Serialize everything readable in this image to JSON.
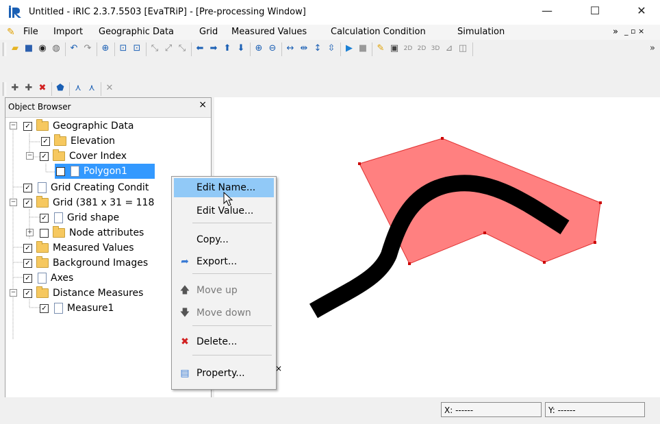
{
  "window": {
    "title": "Untitled - iRIC 2.3.7.5503 [EvaTRiP] - [Pre-processing Window]",
    "minimize_glyph": "—",
    "maximize_glyph": "☐",
    "close_glyph": "✕"
  },
  "menubar": {
    "items": [
      "File",
      "Import",
      "Geographic Data",
      "Grid",
      "Measured Values",
      "Calculation Condition",
      "Simulation"
    ],
    "overflow": "»",
    "mdi_buttons": "_ ▫ ×"
  },
  "object_browser": {
    "title": "Object Browser",
    "close_glyph": "×",
    "tree": [
      {
        "label": "Geographic Data",
        "checked": true,
        "icon": "folder-icon",
        "expander": "−"
      },
      {
        "label": "Elevation",
        "checked": true,
        "icon": "folder-icon"
      },
      {
        "label": "Cover Index",
        "checked": true,
        "icon": "folder-icon",
        "expander": "−"
      },
      {
        "label": "Polygon1",
        "checked": true,
        "icon": "document-icon",
        "selected": true
      },
      {
        "label": "Grid Creating Condit",
        "checked": true,
        "icon": "document-icon"
      },
      {
        "label": "Grid (381 x 31 = 118",
        "checked": true,
        "icon": "folder-icon",
        "expander": "−"
      },
      {
        "label": "Grid shape",
        "checked": true,
        "icon": "document-icon"
      },
      {
        "label": "Node attributes",
        "checked": false,
        "icon": "folder-icon",
        "expander": "+"
      },
      {
        "label": "Measured Values",
        "checked": true,
        "icon": "folder-icon"
      },
      {
        "label": "Background Images",
        "checked": true,
        "icon": "folder-icon"
      },
      {
        "label": "Axes",
        "checked": true,
        "icon": "document-icon"
      },
      {
        "label": "Distance Measures",
        "checked": true,
        "icon": "folder-icon",
        "expander": "−"
      },
      {
        "label": "Measure1",
        "checked": true,
        "icon": "document-icon"
      }
    ]
  },
  "context_menu": {
    "items": [
      {
        "label": "Edit Name...",
        "icon": "",
        "highlighted": true
      },
      {
        "label": "Edit Value...",
        "icon": ""
      },
      {
        "separator": true
      },
      {
        "label": "Copy...",
        "icon": ""
      },
      {
        "label": "Export...",
        "icon": "export-icon"
      },
      {
        "separator": true
      },
      {
        "label": "Move up",
        "icon": "arrow-up-icon",
        "disabled": true
      },
      {
        "label": "Move down",
        "icon": "arrow-down-icon",
        "disabled": true
      },
      {
        "separator": true
      },
      {
        "label": "Delete...",
        "icon": "delete-icon"
      },
      {
        "separator": true
      },
      {
        "label": "Property...",
        "icon": "property-icon"
      }
    ]
  },
  "statusbar": {
    "x_label": "X: ------",
    "y_label": "Y: ------"
  },
  "colors": {
    "polygon_fill": "#ff8080",
    "polygon_stroke": "#e03030",
    "measure_line": "#000000",
    "selection": "#3399ff",
    "menu_highlight": "#91c9f7"
  }
}
